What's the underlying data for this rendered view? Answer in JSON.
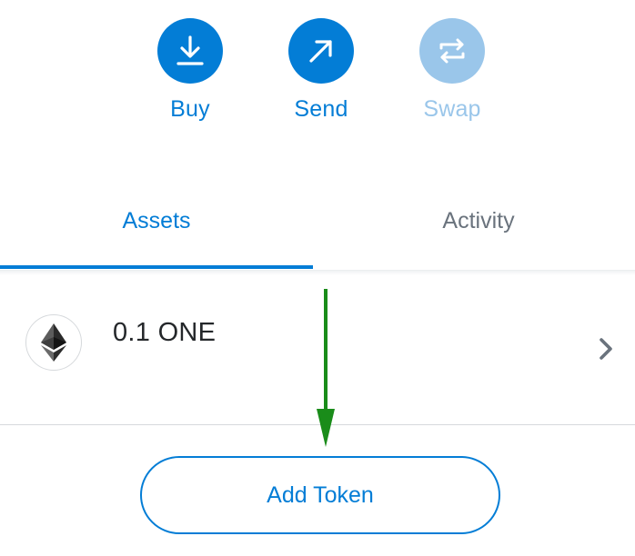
{
  "colors": {
    "primary": "#037dd6",
    "primary_disabled": "#9ac6ea",
    "text_muted": "#6a737d",
    "text_dark": "#24272a",
    "annotation_arrow": "#1a8c1a"
  },
  "actions": {
    "buy": {
      "label": "Buy",
      "icon": "download-icon"
    },
    "send": {
      "label": "Send",
      "icon": "arrow-up-right-icon"
    },
    "swap": {
      "label": "Swap",
      "icon": "swap-arrows-icon"
    }
  },
  "tabs": [
    {
      "label": "Assets",
      "active": true
    },
    {
      "label": "Activity",
      "active": false
    }
  ],
  "assets": [
    {
      "amount": "0.1 ONE",
      "icon": "ethereum-icon"
    }
  ],
  "add_token": {
    "label": "Add Token"
  }
}
